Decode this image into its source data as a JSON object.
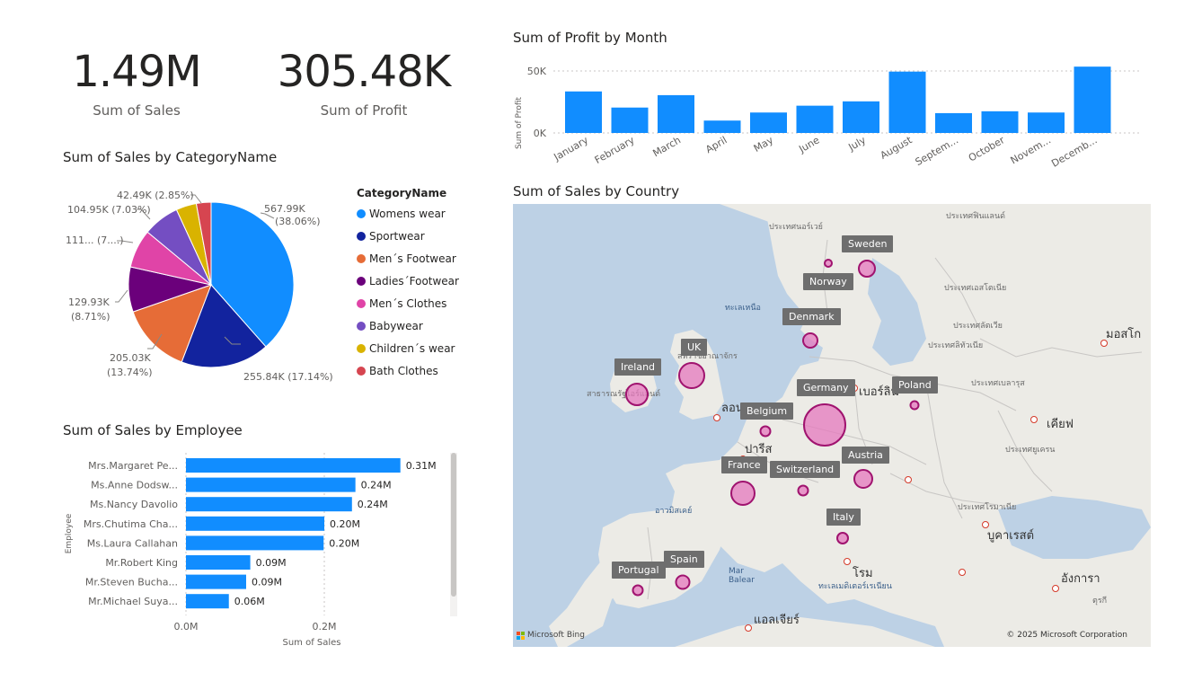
{
  "kpis": [
    {
      "value": "1.49M",
      "label": "Sum of Sales"
    },
    {
      "value": "305.48K",
      "label": "Sum of Profit"
    }
  ],
  "profit_chart": {
    "title": "Sum of Profit by Month",
    "y_axis_title": "Sum of Profit",
    "y_ticks": [
      "50K",
      "0K"
    ],
    "month_labels": [
      "January",
      "February",
      "March",
      "April",
      "May",
      "June",
      "July",
      "August",
      "Septem...",
      "October",
      "Novem...",
      "Decemb..."
    ]
  },
  "pie_chart": {
    "title": "Sum of Sales by CategoryName",
    "legend_title": "CategoryName",
    "slice_labels": [
      [
        "567.99K",
        "(38.06%)"
      ],
      [
        "255.84K (17.14%)"
      ],
      [
        "205.03K",
        "(13.74%)"
      ],
      [
        "129.93K",
        "(8.71%)"
      ],
      [
        "111... (7....)"
      ],
      [
        "104.95K (7.03%)"
      ],
      [
        "42.49K (2.85%)"
      ]
    ]
  },
  "employee_chart": {
    "title": "Sum of Sales by Employee",
    "y_axis_title": "Employee",
    "x_axis_title": "Sum of Sales",
    "x_ticks": [
      "0.0M",
      "0.2M"
    ],
    "employees": [
      "Mrs.Margaret Pe...",
      "Ms.Anne Dodsw...",
      "Ms.Nancy Davolio",
      "Mrs.Chutima Cha...",
      "Ms.Laura Callahan",
      "Mr.Robert King",
      "Mr.Steven Bucha...",
      "Mr.Michael Suya..."
    ],
    "value_labels": [
      "0.31M",
      "0.24M",
      "0.24M",
      "0.20M",
      "0.20M",
      "0.09M",
      "0.09M",
      "0.06M"
    ]
  },
  "map": {
    "title": "Sum of Sales by Country",
    "countries": [
      "Sweden",
      "Norway",
      "Denmark",
      "UK",
      "Ireland",
      "Germany",
      "Poland",
      "Belgium",
      "Austria",
      "France",
      "Switzerland",
      "Italy",
      "Spain",
      "Portugal"
    ],
    "attribution_left": "Microsoft Bing",
    "attribution_right": "© 2025 Microsoft Corporation",
    "place_labels": [
      "ประเทศนอร์เวย์",
      "ประเทศฟินแลนด์",
      "ประเทศเอสโตเนีย",
      "ประเทศลัตเวีย",
      "ประเทศลิทัวเนีย",
      "ประเทศเบลารุส",
      "ทะเลเหนือ",
      "มอสโก",
      "เบอร์ลิน",
      "ลอนดอน",
      "ปารีส",
      "เคียฟ",
      "ประเทศยูเครน",
      "อาวมิสเคย์",
      "โรม",
      "บูคาเรสต์",
      "อังการา",
      "แอลเจียร์",
      "ทะเลเมดิเตอร์เรเนียน",
      "ประเทศโรมาเนีย",
      "Mar Balear",
      "สาธารณรัฐไอร์แลนด์",
      "สหราชอาณาจักร",
      "ตุรกี"
    ]
  },
  "chart_data": [
    {
      "type": "bar",
      "title": "Sum of Profit by Month",
      "categories": [
        "January",
        "February",
        "March",
        "April",
        "May",
        "June",
        "July",
        "August",
        "September",
        "October",
        "November",
        "December"
      ],
      "values": [
        33500,
        20500,
        30500,
        10000,
        16500,
        22000,
        25500,
        49500,
        16000,
        17500,
        16500,
        53500
      ],
      "ylabel": "Sum of Profit",
      "ylim": [
        0,
        55000
      ]
    },
    {
      "type": "pie",
      "title": "Sum of Sales by CategoryName",
      "categories": [
        "Womens wear",
        "Sportwear",
        "Men´s Footwear",
        "Ladies´Footwear",
        "Men´s Clothes",
        "Babywear",
        "Children´s wear",
        "Bath Clothes"
      ],
      "values": [
        567990,
        255840,
        205030,
        129930,
        111000,
        104950,
        59000,
        42490
      ],
      "colors": [
        "#118dff",
        "#12239e",
        "#e66c37",
        "#6b007b",
        "#e044a7",
        "#744ec2",
        "#d9b300",
        "#d64550"
      ]
    },
    {
      "type": "bar",
      "title": "Sum of Sales by Employee",
      "categories": [
        "Mrs.Margaret Pe...",
        "Ms.Anne Dodsw...",
        "Ms.Nancy Davolio",
        "Mrs.Chutima Cha...",
        "Ms.Laura Callahan",
        "Mr.Robert King",
        "Mr.Steven Bucha...",
        "Mr.Michael Suya..."
      ],
      "values": [
        310000,
        245000,
        240000,
        200000,
        199000,
        93000,
        87000,
        62000
      ],
      "xlabel": "Sum of Sales",
      "ylabel": "Employee",
      "xlim": [
        0,
        0.33
      ]
    }
  ],
  "colors": {
    "accent": "#118dff",
    "bubble_fill": "#e678be",
    "bubble_stroke": "#a0136f"
  }
}
